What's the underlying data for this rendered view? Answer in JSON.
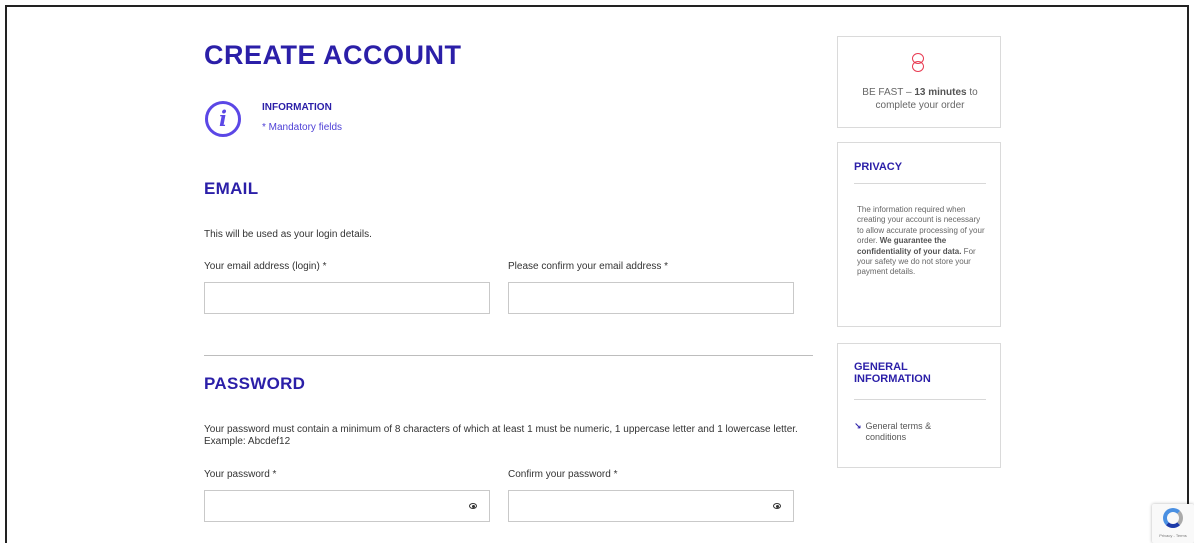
{
  "page_title": "CREATE ACCOUNT",
  "info": {
    "icon": "info-circle-icon",
    "title": "INFORMATION",
    "mandatory": "* Mandatory fields"
  },
  "email": {
    "title": "EMAIL",
    "description": "This will be used as your login details.",
    "label_login": "Your email address (login)  *",
    "label_confirm": "Please confirm your email address  *",
    "value_login": "",
    "value_confirm": ""
  },
  "password": {
    "title": "PASSWORD",
    "description": "Your password must contain a minimum of 8 characters of which at least 1 must be numeric, 1 uppercase letter and 1 lowercase letter. Example: Abcdef12",
    "label_password": "Your password  *",
    "label_confirm": "Confirm your password  *",
    "value_password": "",
    "value_confirm": "",
    "toggle_icon": "eye-icon"
  },
  "sidebar": {
    "timer": {
      "icon": "timer-icon",
      "prefix": "BE FAST – ",
      "bold": "13 minutes",
      "suffix": " to complete your order"
    },
    "privacy": {
      "title": "PRIVACY",
      "text": "The information required when creating your account is necessary to allow accurate processing of your order. ",
      "bold": "We guarantee the confidentiality of your data.",
      "text2": " For your safety we do not store your payment details."
    },
    "general": {
      "title": "GENERAL INFORMATION",
      "link_arrow": "↘",
      "link": "General terms & conditions"
    }
  },
  "recaptcha": {
    "text": "Privacy - Terms"
  },
  "colors": {
    "brand": "#2b1fa8",
    "accent": "#5b47e6",
    "timer": "#e83b52"
  }
}
